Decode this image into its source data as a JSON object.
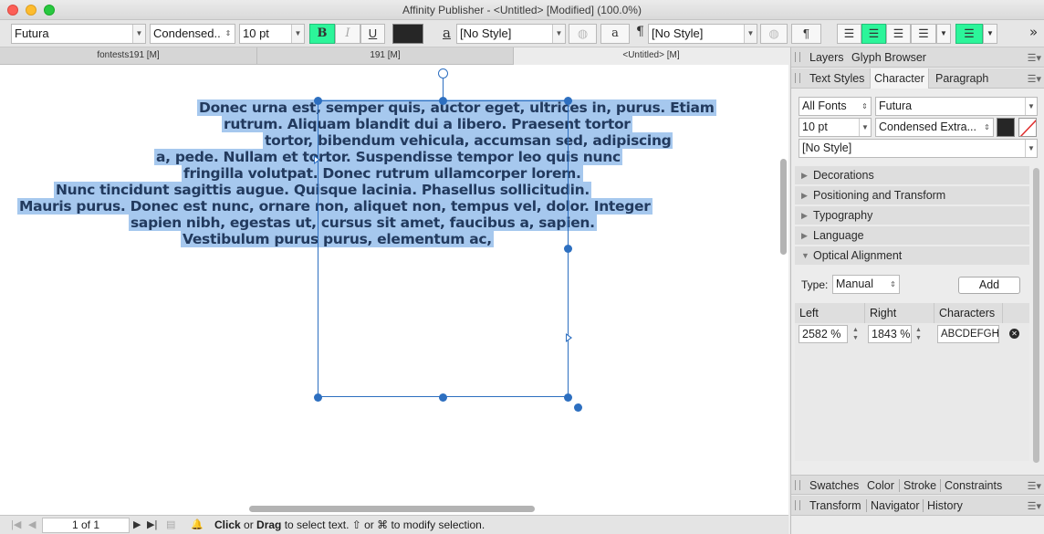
{
  "window": {
    "title": "Affinity Publisher - <Untitled> [Modified] (100.0%)"
  },
  "toolbar": {
    "font_family": "Futura",
    "font_style": "Condensed...",
    "font_size": "10 pt",
    "bold_label": "B",
    "italic_label": "I",
    "underline_label": "U",
    "text_color": "#262626",
    "char_style_glyph": "a",
    "char_style": "[No Style]",
    "char_style_a_label": "a",
    "para_style_glyph": "¶",
    "para_style": "[No Style]",
    "para_mark_label": "¶",
    "accent_color": "#2cf59a",
    "overflow_label": "»"
  },
  "doc_tabs": [
    {
      "label": "fontests191 [M]"
    },
    {
      "label": "191 [M]"
    },
    {
      "label": "<Untitled> [M]"
    }
  ],
  "canvas": {
    "lines": [
      "Donec urna est, semper quis, auctor eget, ultrices in, purus. Etiam",
      "rutrum. Aliquam blandit dui a libero. Praesent tortor",
      "tortor, bibendum vehicula, accumsan sed, adipiscing",
      "a, pede. Nullam et tortor. Suspendisse tempor leo quis nunc",
      "fringilla volutpat. Donec rutrum ullamcorper lorem.",
      "Nunc tincidunt sagittis augue. Quisque lacinia. Phasellus sollicitudin.",
      "Mauris purus. Donec est nunc, ornare non, aliquet non, tempus vel, dolor. Integer",
      "sapien nibh, egestas ut, cursus sit amet, faucibus a, sapien.",
      "Vestibulum purus purus, elementum ac,"
    ],
    "text_color": "#223a5e",
    "selection_color": "#a6c8ee",
    "frame_color": "#2d6fc0"
  },
  "status": {
    "page_indicator": "1 of 1",
    "hint_click": "Click",
    "hint_or": " or ",
    "hint_drag": "Drag",
    "hint_rest": " to select text. ⇧ or ⌘ to modify selection."
  },
  "panel": {
    "top_tabs": [
      "Layers",
      "Glyph Browser"
    ],
    "style_tabs": [
      "Text Styles",
      "Character",
      "Paragraph"
    ],
    "font_filter": "All Fonts",
    "font_family": "Futura",
    "font_size": "10 pt",
    "font_style": "Condensed Extra...",
    "style": "[No Style]",
    "sections": [
      {
        "label": "Decorations",
        "expanded": false
      },
      {
        "label": "Positioning and Transform",
        "expanded": false
      },
      {
        "label": "Typography",
        "expanded": false
      },
      {
        "label": "Language",
        "expanded": false
      },
      {
        "label": "Optical Alignment",
        "expanded": true
      }
    ],
    "optical": {
      "type_label": "Type:",
      "type_value": "Manual",
      "add_label": "Add",
      "headers": [
        "Left",
        "Right",
        "Characters"
      ],
      "row": {
        "left": "2582 %",
        "right": "1843 %",
        "characters": "ABCDEFGH"
      }
    },
    "bottom_tabs_1": [
      "Swatches",
      "Color",
      "Stroke",
      "Constraints"
    ],
    "bottom_tabs_2": [
      "Transform",
      "Navigator",
      "History"
    ]
  }
}
